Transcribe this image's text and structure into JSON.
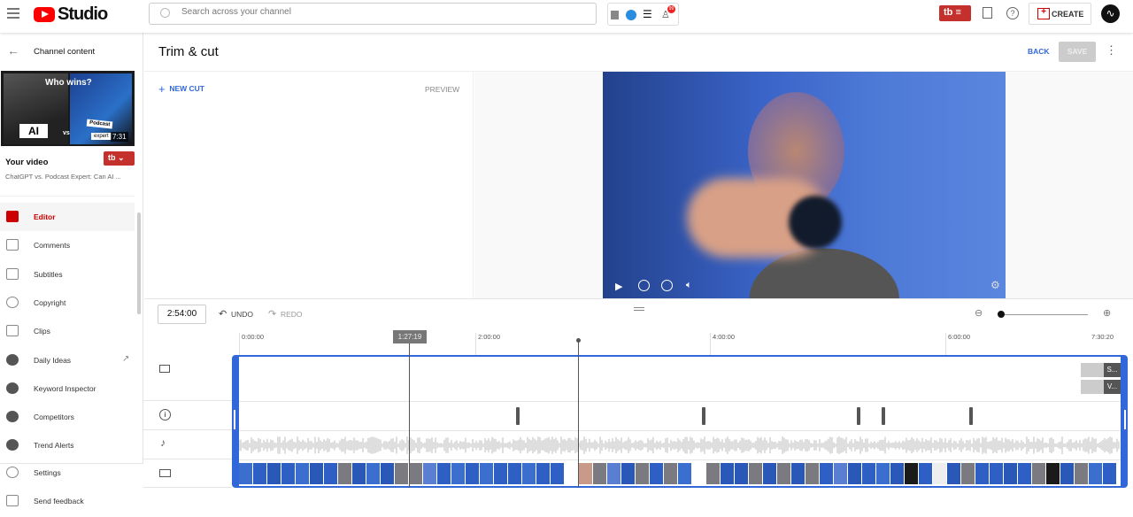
{
  "topbar": {
    "app_name": "Studio",
    "search_placeholder": "Search across your channel",
    "notification_count": "99",
    "create_label": "CREATE",
    "tubebuddy_label": "tb"
  },
  "sidebar": {
    "back_label": "Channel content",
    "video_duration": "7:31",
    "thumbnail_text": [
      "Who wins?",
      "AI",
      "vs",
      "Podcast",
      "expert"
    ],
    "your_video_label": "Your video",
    "video_title": "ChatGPT vs. Podcast Expert: Can AI ...",
    "tb_badge": "tb",
    "items": [
      {
        "label": "Editor",
        "icon": "clapperboard-icon",
        "active": true
      },
      {
        "label": "Comments",
        "icon": "comment-icon"
      },
      {
        "label": "Subtitles",
        "icon": "subtitles-icon"
      },
      {
        "label": "Copyright",
        "icon": "copyright-icon"
      },
      {
        "label": "Clips",
        "icon": "scissors-icon"
      },
      {
        "label": "Daily Ideas",
        "icon": "tubebuddy-icon",
        "external": true
      },
      {
        "label": "Keyword Inspector",
        "icon": "tubebuddy-icon"
      },
      {
        "label": "Competitors",
        "icon": "tubebuddy-icon"
      },
      {
        "label": "Trend Alerts",
        "icon": "tubebuddy-icon"
      }
    ],
    "footer": [
      {
        "label": "Settings",
        "icon": "gear-icon"
      },
      {
        "label": "Send feedback",
        "icon": "feedback-icon"
      }
    ]
  },
  "header": {
    "title": "Trim & cut",
    "back_label": "BACK",
    "save_label": "SAVE"
  },
  "panel": {
    "new_cut_label": "NEW CUT",
    "preview_label": "PREVIEW"
  },
  "timeline": {
    "current_time": "2:54:00",
    "undo_label": "UNDO",
    "redo_label": "REDO",
    "playhead_label": "1:27:19",
    "zoom_level": 0,
    "ruler": [
      "0:00:00",
      "2:00:00",
      "4:00:00",
      "6:00:00",
      "7:30:20"
    ],
    "end_screen_items": [
      "S...",
      "V..."
    ],
    "accent": "#3167d8"
  }
}
